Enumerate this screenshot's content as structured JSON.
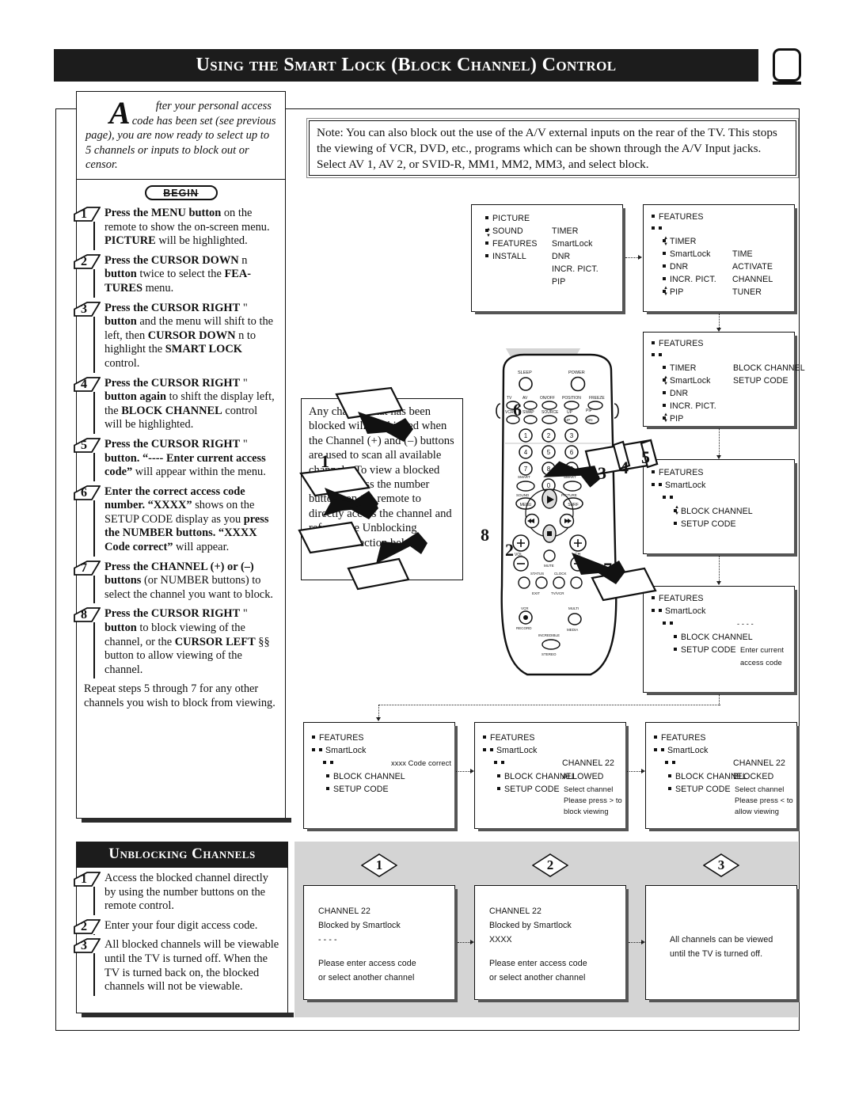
{
  "header": {
    "title": "Using the Smart Lock (Block Channel) Control",
    "corner_icon": "tv-screen-icon"
  },
  "intro": {
    "dropcap": "A",
    "text": "fter your personal access code has been set (see previous page), you are now ready to select up to 5 channels or inputs to block out or censor.",
    "begin_label": "BEGIN"
  },
  "steps": [
    {
      "num": "1",
      "html": "<b>Press the MENU button</b> on the remote to show the on-screen menu. <b>PICTURE</b> will be highlighted."
    },
    {
      "num": "2",
      "html": "<b>Press the CURSOR DOWN</b> n <b>button</b> twice to select the <b>FEA-TURES</b> menu."
    },
    {
      "num": "3",
      "html": "<b>Press the CURSOR RIGHT</b> &quot; <b>button</b> and the menu will shift to the left, then <b>CURSOR DOWN</b> n to highlight the <b>SMART LOCK</b> control."
    },
    {
      "num": "4",
      "html": "<b>Press the CURSOR RIGHT</b> &quot; <b>button again</b> to shift the display left, the <b>BLOCK CHANNEL</b> control will be highlighted."
    },
    {
      "num": "5",
      "html": "<b>Press the CURSOR RIGHT</b> &quot; <b>button. &ldquo;---- Enter current access code&rdquo;</b> will appear within the menu."
    },
    {
      "num": "6",
      "html": "<b>Enter the correct access code number. &ldquo;XXXX&rdquo;</b> shows on the SETUP CODE display as you <b>press the NUMBER buttons. &ldquo;XXXX Code correct&rdquo;</b> will appear."
    },
    {
      "num": "7",
      "html": "<b>Press the CHANNEL (+) or (&ndash;) buttons</b> (or NUMBER buttons) to select the channel you want to block."
    },
    {
      "num": "8",
      "html": "<b>Press the CURSOR RIGHT</b> &quot; <b>button</b> to block viewing of the channel, or the <b>CURSOR LEFT</b> §§ button to allow viewing of the channel."
    }
  ],
  "repeat_note": "Repeat steps 5 through 7 for any other channels you wish to block from viewing.",
  "unblocking": {
    "title": "Unblocking Channels",
    "steps": [
      {
        "num": "1",
        "text": "Access the blocked channel directly by using the number buttons on the remote control."
      },
      {
        "num": "2",
        "text": "Enter your four digit access code."
      },
      {
        "num": "3",
        "text": "All blocked channels will be viewable until the TV is turned off. When the TV is turned back on, the blocked channels will not be viewable."
      }
    ]
  },
  "note": {
    "text": "Note: You can also block out the use of the A/V external inputs on the rear of the TV. This stops the viewing of VCR, DVD, etc., programs which can be shown through the A/V Input jacks. Select AV 1, AV 2, or SVID-R, MM1, MM2, MM3, and select block."
  },
  "center_note": {
    "text": "Any channel that has been blocked will be skipped when the Channel (+) and (–) buttons are used to scan all available channels. To view a blocked channel, press the number buttons on the remote to directly access the channel and refer to the Unblocking Channels section below."
  },
  "menus": {
    "m1": {
      "name": "main-menu",
      "col1": [
        "PICTURE",
        "SOUND",
        "FEATURES",
        "INSTALL"
      ],
      "col2": [
        "TIMER",
        "SmartLock",
        "DNR",
        "INCR. PICT.",
        "PIP"
      ]
    },
    "m2": {
      "name": "features-menu",
      "header": "FEATURES",
      "col1": [
        "TIMER",
        "SmartLock",
        "DNR",
        "INCR. PICT.",
        "PIP"
      ],
      "col2": [
        "TIME",
        "ACTIVATE",
        "CHANNEL",
        "TUNER"
      ]
    },
    "m3": {
      "name": "features-smartlock-menu",
      "header": "FEATURES",
      "col1": [
        "TIMER",
        "SmartLock",
        "DNR",
        "INCR. PICT.",
        "PIP"
      ],
      "col2": [
        "BLOCK CHANNEL",
        "SETUP CODE"
      ]
    },
    "m4": {
      "name": "smartlock-submenu",
      "header": "FEATURES",
      "sub": "SmartLock",
      "items": [
        "BLOCK CHANNEL",
        "SETUP CODE"
      ]
    },
    "m5": {
      "name": "enter-access-code-menu",
      "header": "FEATURES",
      "sub": "SmartLock",
      "dashes": "- - - -",
      "items": [
        "BLOCK CHANNEL",
        "SETUP CODE"
      ],
      "value_lines": [
        "Enter current",
        "access code"
      ]
    },
    "m6": {
      "name": "code-correct-menu",
      "header": "FEATURES",
      "sub": "SmartLock",
      "status": "xxxx Code correct",
      "items": [
        "BLOCK CHANNEL",
        "SETUP CODE"
      ]
    },
    "m7": {
      "name": "channel-allowed-menu",
      "header": "FEATURES",
      "sub": "SmartLock",
      "channel": "CHANNEL 22",
      "items": [
        "BLOCK CHANNEL",
        "SETUP CODE"
      ],
      "state": "ALLOWED",
      "hint_lines": [
        "Select channel",
        "Please press > to",
        "block viewing"
      ]
    },
    "m8": {
      "name": "channel-blocked-menu",
      "header": "FEATURES",
      "sub": "SmartLock",
      "channel": "CHANNEL 22",
      "items": [
        "BLOCK CHANNEL",
        "SETUP CODE"
      ],
      "state": "BLOCKED",
      "hint_lines": [
        "Select channel",
        "Please press < to",
        "allow viewing"
      ]
    }
  },
  "unblock_screens": [
    {
      "num": "1",
      "lines": [
        "CHANNEL 22",
        "Blocked by Smartlock",
        "- - - -"
      ],
      "footer": [
        "Please enter access code",
        "or select another channel"
      ]
    },
    {
      "num": "2",
      "lines": [
        "CHANNEL 22",
        "Blocked by Smartlock",
        "XXXX"
      ],
      "footer": [
        "Please enter access code",
        "or select another channel"
      ]
    },
    {
      "num": "3",
      "lines": [],
      "footer": [
        "All channels can be viewed",
        "until the TV is turned off."
      ]
    }
  ],
  "remote": {
    "name": "tv-remote-control",
    "top_labels": [
      "SLEEP",
      "POWER"
    ],
    "row1": [
      "TV",
      "AV",
      "ON/OFF",
      "POSITION",
      "FREEZE"
    ],
    "row2": [
      "VCR",
      "SWAP",
      "SOURCE",
      "UP",
      "PIP",
      "DN"
    ],
    "keypad": [
      "1",
      "2",
      "3",
      "4",
      "5",
      "6",
      "7",
      "8",
      "9",
      "0"
    ],
    "smart_sound": "SMART SOUND",
    "smart_picture": "SMART PICTURE",
    "menu": "MENU",
    "surf": "SURF",
    "vol": "VOL",
    "ch": "CH",
    "mute": "MUTE",
    "status_exit": "STATUS EXIT",
    "clock_tvvcr": "CLOCK TV/VCR",
    "vcr_record": "VCR RECORD",
    "multi_media": "MULTI MEDIA",
    "incredible_stereo": "INCREDIBLE STEREO",
    "callouts": [
      "1",
      "2",
      "3",
      "4",
      "5",
      "6",
      "7",
      "8"
    ]
  }
}
